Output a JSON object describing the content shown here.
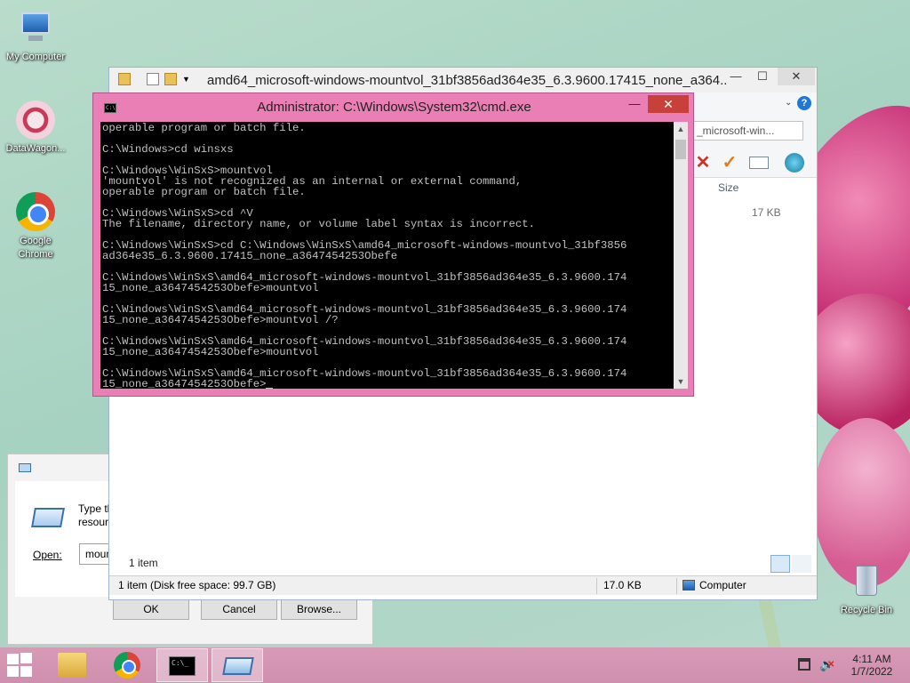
{
  "desktop": {
    "icons": [
      {
        "label": "My Computer"
      },
      {
        "label": "DataWagon..."
      },
      {
        "label": "Google Chrome"
      },
      {
        "label": "Recycle Bin"
      }
    ]
  },
  "run_dialog": {
    "description": "Type the\nresource",
    "open_label": "Open:",
    "open_value": "mount",
    "ok_label": "OK",
    "cancel_label": "Cancel",
    "browse_label": "Browse..."
  },
  "explorer": {
    "title": "amd64_microsoft-windows-mountvol_31bf3856ad364e35_6.3.9600.17415_none_a364...",
    "search_placeholder": "_microsoft-win...",
    "column_size": "Size",
    "file_size": "17 KB",
    "item_count": "1 item",
    "status_left": "1 item (Disk free space: 99.7 GB)",
    "status_size": "17.0 KB",
    "status_location": "Computer",
    "min_label": "—",
    "max_label": "☐",
    "close_label": "✕"
  },
  "cmd": {
    "title": "Administrator: C:\\Windows\\System32\\cmd.exe",
    "icon_text": "C:\\",
    "min_label": "—",
    "close_label": "✕",
    "output": "operable program or batch file.\n\nC:\\Windows>cd winsxs\n\nC:\\Windows\\WinSxS>mountvol\n'mountvol' is not recognized as an internal or external command,\noperable program or batch file.\n\nC:\\Windows\\WinSxS>cd ^V\nThe filename, directory name, or volume label syntax is incorrect.\n\nC:\\Windows\\WinSxS>cd C:\\Windows\\WinSxS\\amd64_microsoft-windows-mountvol_31bf3856\nad364e35_6.3.9600.17415_none_a3647454253Obefe\n\nC:\\Windows\\WinSxS\\amd64_microsoft-windows-mountvol_31bf3856ad364e35_6.3.9600.174\n15_none_a3647454253Obefe>mountvol\n\nC:\\Windows\\WinSxS\\amd64_microsoft-windows-mountvol_31bf3856ad364e35_6.3.9600.174\n15_none_a3647454253Obefe>mountvol /?\n\nC:\\Windows\\WinSxS\\amd64_microsoft-windows-mountvol_31bf3856ad364e35_6.3.9600.174\n15_none_a3647454253Obefe>mountvol\n\nC:\\Windows\\WinSxS\\amd64_microsoft-windows-mountvol_31bf3856ad364e35_6.3.9600.174\n15_none_a3647454253Obefe>"
  },
  "taskbar": {
    "time": "4:11 AM",
    "date": "1/7/2022",
    "cmd_icon_text": "C:\\_"
  }
}
